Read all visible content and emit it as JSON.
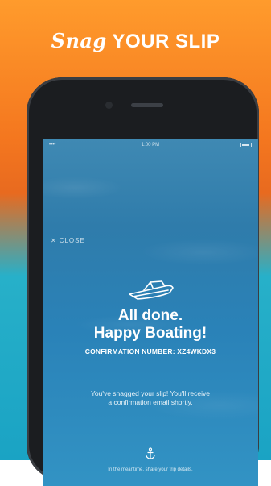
{
  "promo": {
    "headline_script": "Snag",
    "headline_caps": "YOUR SLIP"
  },
  "status_bar": {
    "carrier": "•••• ",
    "time": "1:00 PM"
  },
  "screen": {
    "close_label": "CLOSE",
    "title_line1": "All done.",
    "title_line2": "Happy Boating!",
    "confirmation": "CONFIRMATION NUMBER: XZ4WKDX3",
    "message": "You've snagged your slip! You'll receive a confirmation email shortly.",
    "footer": "In the meantime, share your trip details."
  },
  "icons": {
    "close": "close-icon",
    "boat": "boat-icon",
    "anchor": "anchor-icon"
  },
  "colors": {
    "promo_orange": "#f4771f",
    "promo_teal": "#1aa3c4",
    "screen_blue": "#2f7cab",
    "text": "#ffffff"
  }
}
